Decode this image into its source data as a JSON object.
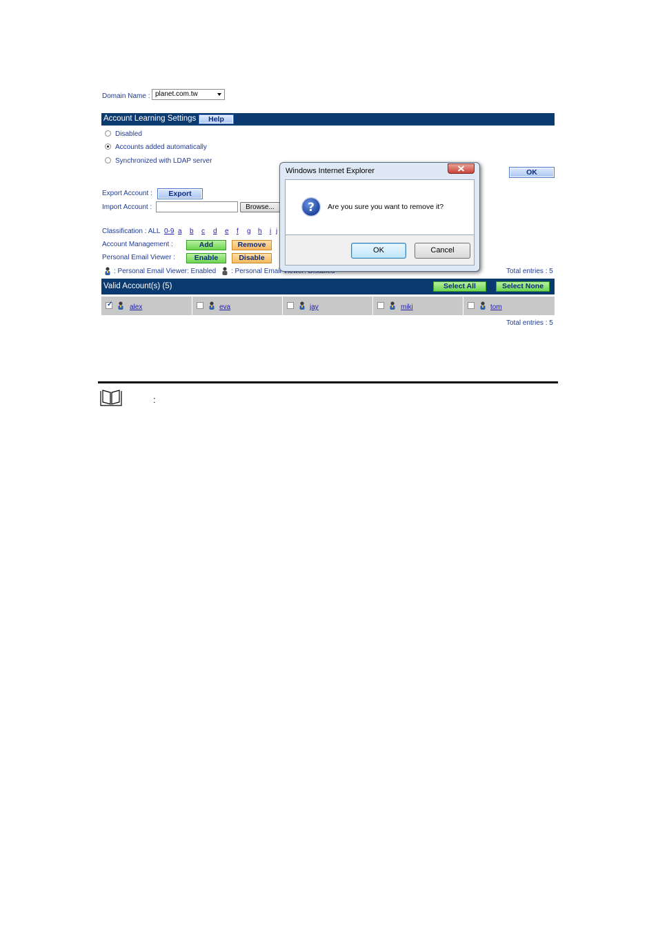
{
  "domain": {
    "label": "Domain Name :",
    "value": "planet.com.tw"
  },
  "learning": {
    "title": "Account Learning Settings",
    "help_label": "Help",
    "options": [
      "Disabled",
      "Accounts added automatically",
      "Synchronized with LDAP server"
    ],
    "selected_index": 1,
    "ok_label": "OK"
  },
  "export": {
    "label": "Export Account :",
    "button": "Export"
  },
  "import": {
    "label": "Import Account :",
    "browse": "Browse..."
  },
  "classification": {
    "label": "Classification :",
    "all": "ALL",
    "letters": [
      "0-9",
      "a",
      "b",
      "c",
      "d",
      "e",
      "f",
      "g",
      "h",
      "i",
      "j"
    ]
  },
  "management": {
    "label": "Account Management :",
    "add": "Add",
    "remove": "Remove"
  },
  "viewer": {
    "label": "Personal Email Viewer :",
    "enable": "Enable",
    "disable": "Disable"
  },
  "legend": {
    "enabled": ": Personal Email Viewer: Enabled",
    "disabled": ": Personal Email Viewer: Disabled"
  },
  "totals": {
    "top": "Total entries : 5",
    "bottom": "Total entries : 5"
  },
  "accounts_bar": {
    "title": "Valid Account(s) (5)",
    "select_all": "Select All",
    "select_none": "Select None"
  },
  "accounts": [
    {
      "name": "alex",
      "checked": true
    },
    {
      "name": "eva",
      "checked": false
    },
    {
      "name": "jay",
      "checked": false
    },
    {
      "name": "miki",
      "checked": false
    },
    {
      "name": "tom",
      "checked": false
    }
  ],
  "dialog": {
    "title": "Windows Internet Explorer",
    "message": "Are you sure you want to remove it?",
    "ok": "OK",
    "cancel": "Cancel"
  },
  "note": {
    "colon": ":"
  },
  "colors": {
    "bar": "#0b3a70",
    "link": "#1f1fa3",
    "label": "#1f3a93",
    "close_button": "#c9453a"
  }
}
